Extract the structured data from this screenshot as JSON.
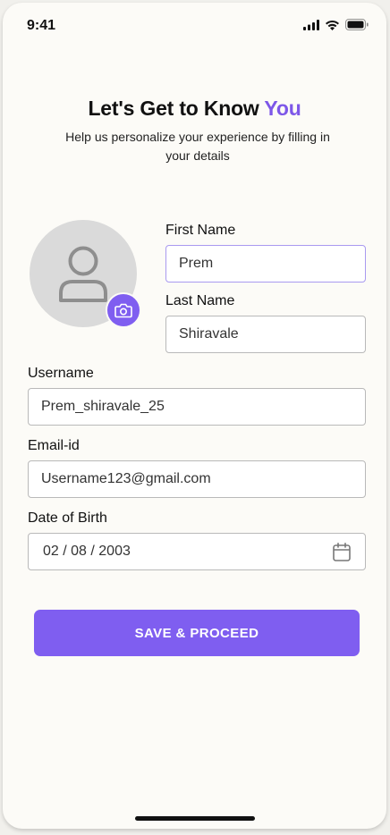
{
  "status_bar": {
    "time": "9:41"
  },
  "header": {
    "title_main": "Let's Get to Know ",
    "title_accent": "You",
    "subtitle": "Help us personalize your experience by filling in your details"
  },
  "form": {
    "first_name": {
      "label": "First Name",
      "value": "Prem"
    },
    "last_name": {
      "label": "Last Name",
      "value": "Shiravale"
    },
    "username": {
      "label": "Username",
      "value": "Prem_shiravale_25"
    },
    "email": {
      "label": "Email-id",
      "value": "Username123@gmail.com"
    },
    "dob": {
      "label": "Date of Birth",
      "value": "02 / 08 / 2003"
    }
  },
  "actions": {
    "save_label": "SAVE  & PROCEED"
  },
  "icons": {
    "avatar": "user-placeholder-icon",
    "camera": "camera-icon",
    "calendar": "calendar-icon",
    "signal": "signal-icon",
    "wifi": "wifi-icon",
    "battery": "battery-icon"
  },
  "colors": {
    "accent": "#7f5ef0",
    "background": "#fcfbf7"
  }
}
